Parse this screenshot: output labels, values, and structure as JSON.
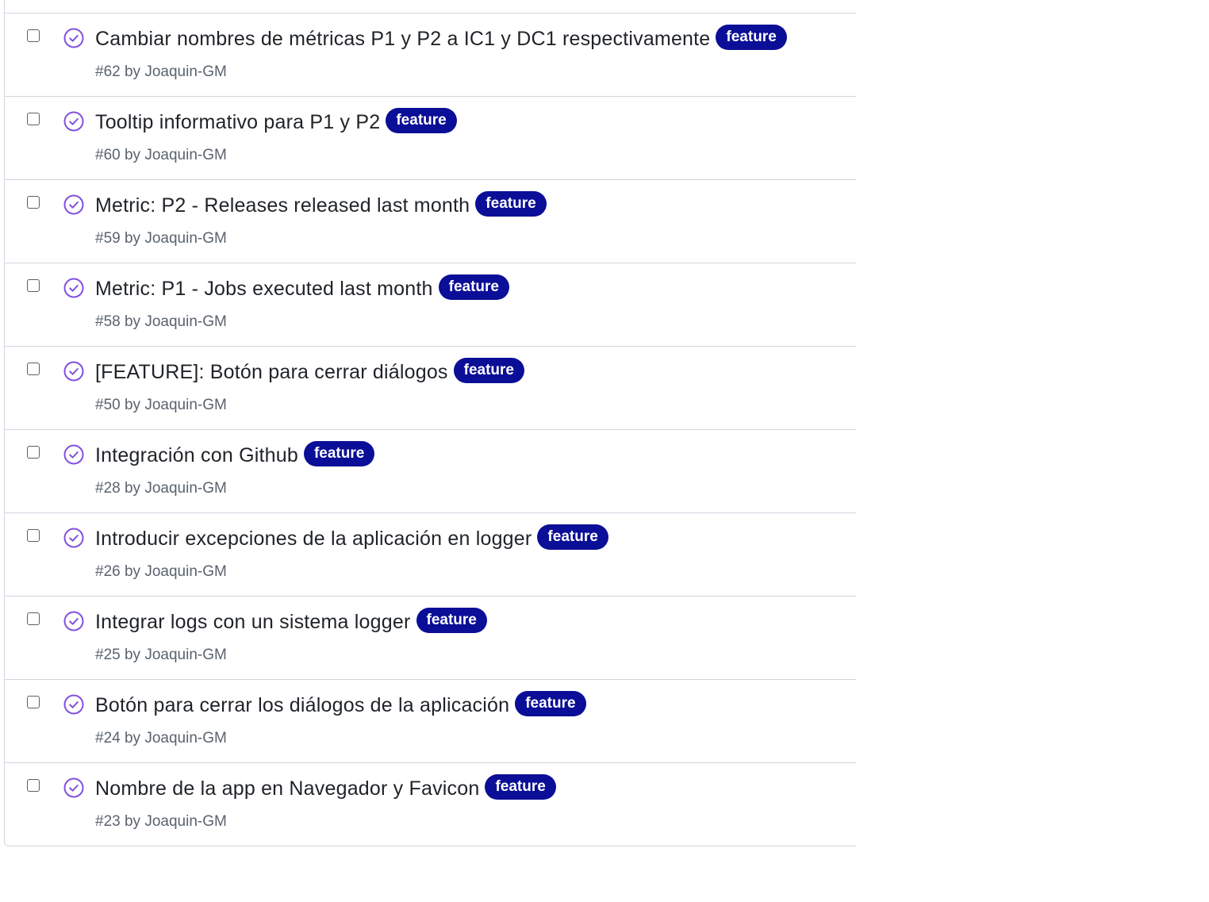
{
  "issues": {
    "badge_color": "#0b0e96",
    "state_icon": "issue-closed-completed-icon",
    "state_color": "#8250df",
    "by_word": "by",
    "items": [
      {
        "title": "Cambiar nombres de métricas P1 y P2 a IC1 y DC1 respectivamente",
        "label": "feature",
        "number": "#62",
        "author": "Joaquin-GM"
      },
      {
        "title": "Tooltip informativo para P1 y P2",
        "label": "feature",
        "number": "#60",
        "author": "Joaquin-GM"
      },
      {
        "title": "Metric: P2 - Releases released last month",
        "label": "feature",
        "number": "#59",
        "author": "Joaquin-GM"
      },
      {
        "title": "Metric: P1 - Jobs executed last month",
        "label": "feature",
        "number": "#58",
        "author": "Joaquin-GM"
      },
      {
        "title": "[FEATURE]: Botón para cerrar diálogos",
        "label": "feature",
        "number": "#50",
        "author": "Joaquin-GM"
      },
      {
        "title": "Integración con Github",
        "label": "feature",
        "number": "#28",
        "author": "Joaquin-GM"
      },
      {
        "title": "Introducir excepciones de la aplicación en logger",
        "label": "feature",
        "number": "#26",
        "author": "Joaquin-GM"
      },
      {
        "title": "Integrar logs con un sistema logger",
        "label": "feature",
        "number": "#25",
        "author": "Joaquin-GM"
      },
      {
        "title": "Botón para cerrar los diálogos de la aplicación",
        "label": "feature",
        "number": "#24",
        "author": "Joaquin-GM"
      },
      {
        "title": "Nombre de la app en Navegador y Favicon",
        "label": "feature",
        "number": "#23",
        "author": "Joaquin-GM"
      }
    ]
  }
}
